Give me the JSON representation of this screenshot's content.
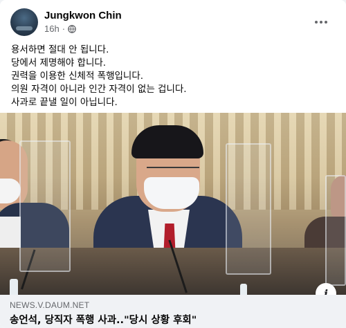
{
  "post": {
    "author": "Jungkwon Chin",
    "time": "16h",
    "separator": "·",
    "privacy_icon": "globe-icon",
    "more_icon": "more-options-icon",
    "lines": [
      "용서하면 절대 안 됩니다.",
      "당에서 제명해야 합니다.",
      "권력을 이용한 신체적 폭행입니다.",
      "의원 자격이 아니라 인간 자격이 없는 겁니다.",
      "사과로 끝낼 일이 아닙니다."
    ]
  },
  "link_preview": {
    "domain": "NEWS.V.DAUM.NET",
    "title": "송언석, 당직자 폭행 사과..\"당시 상황 후회\"",
    "info_icon": "info-icon",
    "info_label": "i"
  },
  "colors": {
    "text_primary": "#050505",
    "text_secondary": "#65676b",
    "footer_bg": "#f0f2f5"
  }
}
